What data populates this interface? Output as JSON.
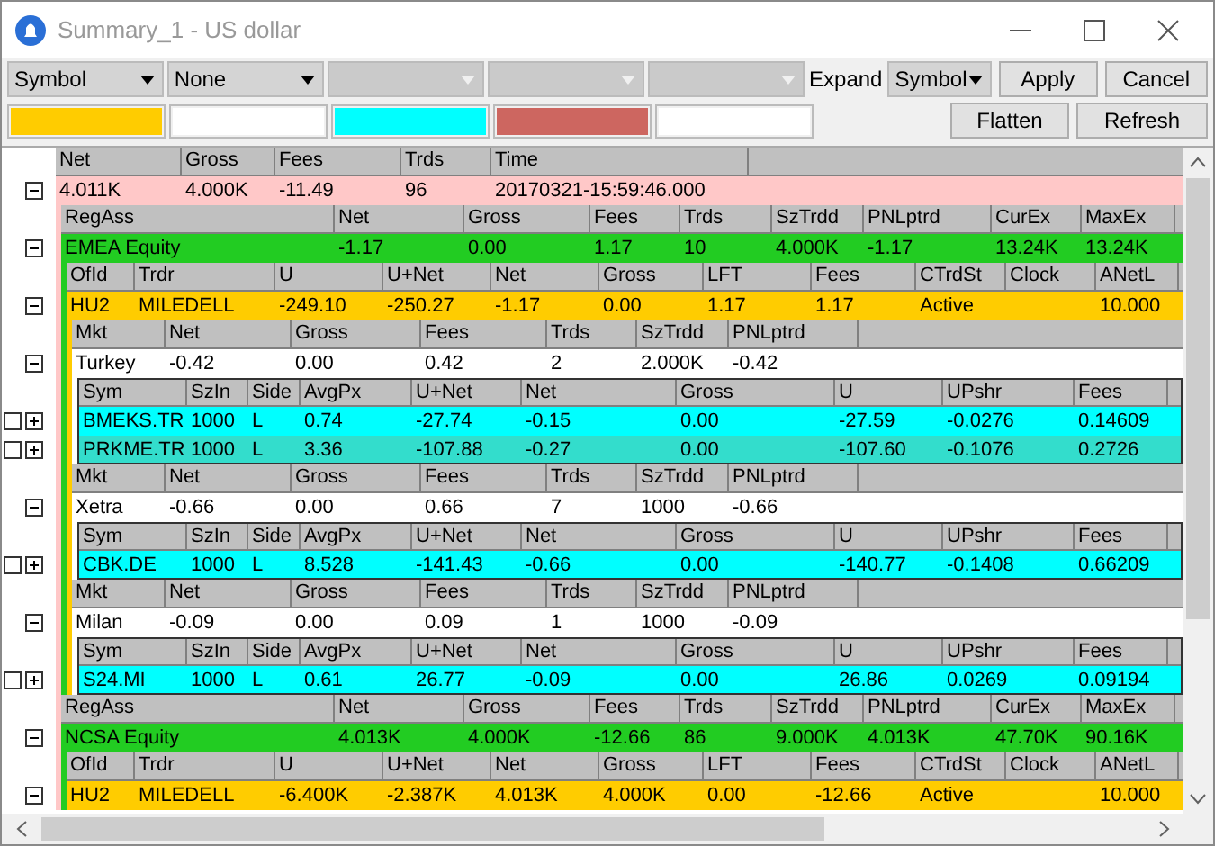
{
  "window": {
    "title": "Summary_1 - US dollar"
  },
  "toolbar": {
    "filters": [
      {
        "value": "Symbol",
        "disabled": false
      },
      {
        "value": "None",
        "disabled": false
      },
      {
        "disabled": true
      },
      {
        "disabled": true
      },
      {
        "disabled": true
      }
    ],
    "swatches": [
      {
        "color": "#ffcc00"
      },
      {
        "color": "#ffffff"
      },
      {
        "color": "#00ffff"
      },
      {
        "color": "#cd6660"
      },
      {
        "color": "#ffffff"
      }
    ],
    "expand": {
      "label": "Expand",
      "value": "Symbol"
    },
    "buttons": [
      "Apply",
      "Cancel",
      "Flatten",
      "Refresh"
    ]
  },
  "grid": {
    "groups": [
      {
        "columns": [
          "Net",
          "Gross",
          "Fees",
          "Trds",
          "Time"
        ],
        "rows": [
          {
            "cells": [
              "4.011K",
              "4.000K",
              "-11.49",
              "96",
              "20170321-15:59:46.000"
            ],
            "color": "#ffc8c8",
            "expanded": true,
            "children": [
              {
                "columns": [
                  "RegAss",
                  "Net",
                  "Gross",
                  "Fees",
                  "Trds",
                  "SzTrdd",
                  "PNLptrd",
                  "CurEx",
                  "MaxEx"
                ],
                "rows": [
                  {
                    "cells": [
                      "EMEA Equity",
                      "-1.17",
                      "0.00",
                      "1.17",
                      "10",
                      "4.000K",
                      "-1.17",
                      "13.24K",
                      "13.24K"
                    ],
                    "color": "#22cc22",
                    "expanded": true,
                    "children": [
                      {
                        "columns": [
                          "OfId",
                          "Trdr",
                          "U",
                          "U+Net",
                          "Net",
                          "Gross",
                          "LFT",
                          "Fees",
                          "CTrdSt",
                          "Clock",
                          "ANetL"
                        ],
                        "rows": [
                          {
                            "cells": [
                              "HU2",
                              "MILEDELL",
                              "-249.10",
                              "-250.27",
                              "-1.17",
                              "0.00",
                              "1.17",
                              "1.17",
                              "Active",
                              null,
                              "10.000"
                            ],
                            "color": "#ffcc00",
                            "expanded": true,
                            "children": [
                              {
                                "columns": [
                                  "Mkt",
                                  "Net",
                                  "Gross",
                                  "Fees",
                                  "Trds",
                                  "SzTrdd",
                                  "PNLptrd"
                                ],
                                "rows": [
                                  {
                                    "cells": [
                                      "Turkey",
                                      "-0.42",
                                      "0.00",
                                      "0.42",
                                      "2",
                                      "2.000K",
                                      "-0.42"
                                    ],
                                    "color": "#ffffff",
                                    "expanded": true,
                                    "children": [
                                      {
                                        "columns": [
                                          "Sym",
                                          "SzIn",
                                          "Side",
                                          "AvgPx",
                                          "U+Net",
                                          "Net",
                                          "Gross",
                                          "U",
                                          "UPshr",
                                          "Fees"
                                        ],
                                        "rows": [
                                          {
                                            "cells": [
                                              "BMEKS.TR",
                                              "1000",
                                              "L",
                                              "0.74",
                                              "-27.74",
                                              "-0.15",
                                              "0.00",
                                              "-27.59",
                                              "-0.0276",
                                              "0.14609"
                                            ],
                                            "color": "#00ffff",
                                            "checked": false,
                                            "expanded": false
                                          },
                                          {
                                            "cells": [
                                              "PRKME.TR",
                                              "1000",
                                              "L",
                                              "3.36",
                                              "-107.88",
                                              "-0.27",
                                              "0.00",
                                              "-107.60",
                                              "-0.1076",
                                              "0.2726"
                                            ],
                                            "color": "#33ddcc",
                                            "checked": false,
                                            "expanded": false
                                          }
                                        ]
                                      }
                                    ]
                                  }
                                ]
                              },
                              {
                                "columns": [
                                  "Mkt",
                                  "Net",
                                  "Gross",
                                  "Fees",
                                  "Trds",
                                  "SzTrdd",
                                  "PNLptrd"
                                ],
                                "rows": [
                                  {
                                    "cells": [
                                      "Xetra",
                                      "-0.66",
                                      "0.00",
                                      "0.66",
                                      "7",
                                      "1000",
                                      "-0.66"
                                    ],
                                    "color": "#ffffff",
                                    "expanded": true,
                                    "children": [
                                      {
                                        "columns": [
                                          "Sym",
                                          "SzIn",
                                          "Side",
                                          "AvgPx",
                                          "U+Net",
                                          "Net",
                                          "Gross",
                                          "U",
                                          "UPshr",
                                          "Fees"
                                        ],
                                        "rows": [
                                          {
                                            "cells": [
                                              "CBK.DE",
                                              "1000",
                                              "L",
                                              "8.528",
                                              "-141.43",
                                              "-0.66",
                                              "0.00",
                                              "-140.77",
                                              "-0.1408",
                                              "0.66209"
                                            ],
                                            "color": "#00ffff",
                                            "checked": false,
                                            "expanded": false
                                          }
                                        ]
                                      }
                                    ]
                                  }
                                ]
                              },
                              {
                                "columns": [
                                  "Mkt",
                                  "Net",
                                  "Gross",
                                  "Fees",
                                  "Trds",
                                  "SzTrdd",
                                  "PNLptrd"
                                ],
                                "rows": [
                                  {
                                    "cells": [
                                      "Milan",
                                      "-0.09",
                                      "0.00",
                                      "0.09",
                                      "1",
                                      "1000",
                                      "-0.09"
                                    ],
                                    "color": "#ffffff",
                                    "expanded": true,
                                    "children": [
                                      {
                                        "columns": [
                                          "Sym",
                                          "SzIn",
                                          "Side",
                                          "AvgPx",
                                          "U+Net",
                                          "Net",
                                          "Gross",
                                          "U",
                                          "UPshr",
                                          "Fees"
                                        ],
                                        "rows": [
                                          {
                                            "cells": [
                                              "S24.MI",
                                              "1000",
                                              "L",
                                              "0.61",
                                              "26.77",
                                              "-0.09",
                                              "0.00",
                                              "26.86",
                                              "0.0269",
                                              "0.09194"
                                            ],
                                            "color": "#00ffff",
                                            "checked": false,
                                            "expanded": false
                                          }
                                        ]
                                      }
                                    ]
                                  }
                                ]
                              }
                            ]
                          }
                        ]
                      }
                    ]
                  }
                ]
              },
              {
                "columns": [
                  "RegAss",
                  "Net",
                  "Gross",
                  "Fees",
                  "Trds",
                  "SzTrdd",
                  "PNLptrd",
                  "CurEx",
                  "MaxEx"
                ],
                "rows": [
                  {
                    "cells": [
                      "NCSA Equity",
                      "4.013K",
                      "4.000K",
                      "-12.66",
                      "86",
                      "9.000K",
                      "4.013K",
                      "47.70K",
                      "90.16K"
                    ],
                    "color": "#22cc22",
                    "expanded": true,
                    "children": [
                      {
                        "columns": [
                          "OfId",
                          "Trdr",
                          "U",
                          "U+Net",
                          "Net",
                          "Gross",
                          "LFT",
                          "Fees",
                          "CTrdSt",
                          "Clock",
                          "ANetL"
                        ],
                        "rows": [
                          {
                            "cells": [
                              "HU2",
                              "MILEDELL",
                              "-6.400K",
                              "-2.387K",
                              "4.013K",
                              "4.000K",
                              "0.00",
                              "-12.66",
                              "Active",
                              null,
                              "10.000"
                            ],
                            "color": "#ffcc00",
                            "expanded": true
                          }
                        ]
                      }
                    ]
                  }
                ]
              }
            ]
          }
        ]
      }
    ]
  }
}
